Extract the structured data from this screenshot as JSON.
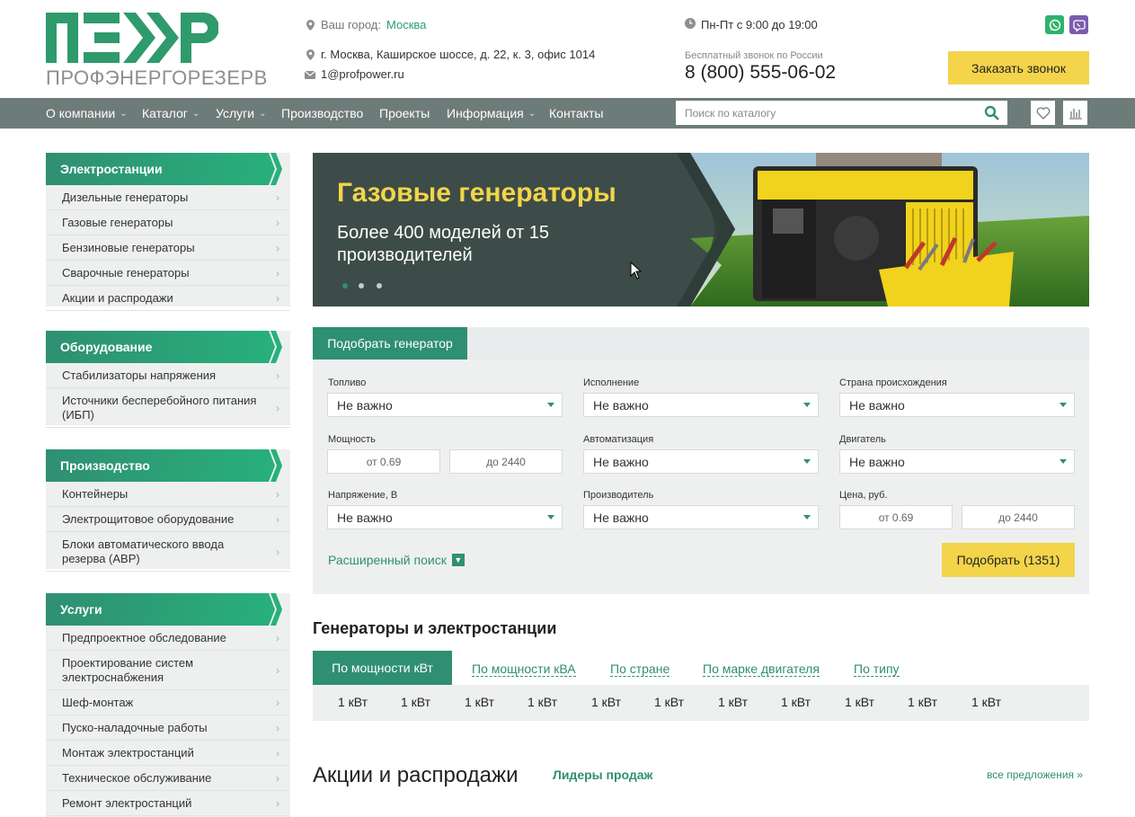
{
  "header": {
    "logo_text": "ПРОФЭНЕРГОРЕЗЕРВ",
    "city_label": "Ваш город:",
    "city": "Москва",
    "address": "г. Москва, Каширское шоссе, д. 22, к. 3, офис 1014",
    "email": "1@profpower.ru",
    "schedule": "Пн-Пт с 9:00 до 19:00",
    "free_call_label": "Бесплатный звонок по России",
    "phone": "8 (800) 555-06-02",
    "callback_button": "Заказать звонок"
  },
  "nav": {
    "items": [
      {
        "label": "О компании",
        "dropdown": true
      },
      {
        "label": "Каталог",
        "dropdown": true
      },
      {
        "label": "Услуги",
        "dropdown": true
      },
      {
        "label": "Производство",
        "dropdown": false
      },
      {
        "label": "Проекты",
        "dropdown": false
      },
      {
        "label": "Информация",
        "dropdown": true
      },
      {
        "label": "Контакты",
        "dropdown": false
      }
    ],
    "search_placeholder": "Поиск по каталогу"
  },
  "sidebar": [
    {
      "title": "Электростанции",
      "items": [
        "Дизельные генераторы",
        "Газовые генераторы",
        "Бензиновые генераторы",
        "Сварочные генераторы",
        "Акции и распродажи"
      ]
    },
    {
      "title": "Оборудование",
      "items": [
        "Стабилизаторы напряжения",
        "Источники бесперебойного питания (ИБП)"
      ]
    },
    {
      "title": "Производство",
      "items": [
        "Контейнеры",
        "Электрощитовое оборудование",
        "Блоки автоматического ввода резерва (АВР)"
      ]
    },
    {
      "title": "Услуги",
      "items": [
        "Предпроектное обследование",
        "Проектирование систем электроснабжения",
        "Шеф-монтаж",
        "Пуско-наладочные работы",
        "Монтаж электростанций",
        "Техническое обслуживание",
        "Ремонт электростанций"
      ]
    }
  ],
  "banner": {
    "title": "Газовые генераторы",
    "subtitle": "Более 400 моделей от 15 производителей",
    "slides": 3,
    "active_slide": 1
  },
  "filter": {
    "tab_label": "Подобрать генератор",
    "fuel_label": "Топливо",
    "fuel_value": "Не важно",
    "execution_label": "Исполнение",
    "execution_value": "Не важно",
    "country_label": "Страна происхождения",
    "country_value": "Не важно",
    "power_label": "Мощность",
    "power_from": "от 0.69",
    "power_to": "до 2440",
    "automation_label": "Автоматизация",
    "automation_value": "Не важно",
    "engine_label": "Двигатель",
    "engine_value": "Не важно",
    "voltage_label": "Напряжение, В",
    "voltage_value": "Не важно",
    "manufacturer_label": "Производитель",
    "manufacturer_value": "Не важно",
    "price_label": "Цена, руб.",
    "price_from": "от 0.69",
    "price_to": "до 2440",
    "advanced_search": "Расширенный поиск",
    "submit": "Подобрать (1351)"
  },
  "generators": {
    "title": "Генераторы и электростанции",
    "tabs": [
      "По мощности кВт",
      "По мощности кВА",
      "По стране",
      "По марке двигателя",
      "По типу"
    ],
    "active_tab": 0,
    "values": [
      "1 кВт",
      "1 кВт",
      "1 кВт",
      "1 кВт",
      "1 кВт",
      "1 кВт",
      "1 кВт",
      "1 кВт",
      "1 кВт",
      "1 кВт",
      "1 кВт"
    ]
  },
  "promo": {
    "title": "Акции и распродажи",
    "tab": "Лидеры продаж",
    "all_link": "все предложения »"
  },
  "colors": {
    "brand_green": "#2f8f72",
    "accent_yellow": "#f3d44a",
    "nav_gray": "#6e7c79",
    "whatsapp": "#2fb36b",
    "viber": "#7b5cae"
  }
}
